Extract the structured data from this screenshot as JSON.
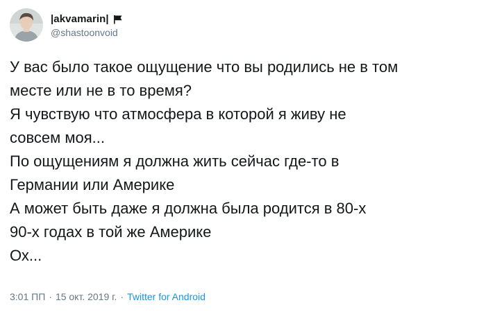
{
  "author": {
    "display_name": "|akvamarin|",
    "handle": "@shastoonvoid",
    "avatar_icon": "user-avatar",
    "flag_icon": "black-flag-icon"
  },
  "tweet": {
    "lines": [
      "У вас было такое ощущение что вы родились не в том",
      "месте или не в то время?",
      "Я чувствую что атмосфера в которой я живу не",
      "совсем моя...",
      "По ощущениям я должна жить сейчас где-то в",
      "Германии или Америке",
      "А может быть даже я должна была родится в 80-х",
      "90-х годах в той же Америке",
      "Ох..."
    ]
  },
  "meta": {
    "time": "3:01 ПП",
    "separator": "·",
    "date": "15 окт. 2019 г.",
    "source": "Twitter for Android"
  },
  "colors": {
    "text": "#14171a",
    "secondary": "#657786",
    "link": "#1b95e0"
  }
}
